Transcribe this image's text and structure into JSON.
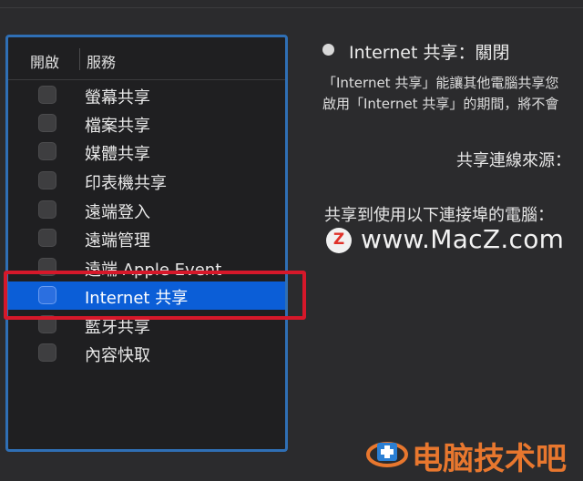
{
  "panel": {
    "header": {
      "enable_col": "開啟",
      "service_col": "服務"
    },
    "services": [
      {
        "label": "螢幕共享",
        "enabled": false,
        "selected": false
      },
      {
        "label": "檔案共享",
        "enabled": false,
        "selected": false
      },
      {
        "label": "媒體共享",
        "enabled": false,
        "selected": false
      },
      {
        "label": "印表機共享",
        "enabled": false,
        "selected": false
      },
      {
        "label": "遠端登入",
        "enabled": false,
        "selected": false
      },
      {
        "label": "遠端管理",
        "enabled": false,
        "selected": false
      },
      {
        "label": "遠端 Apple Event",
        "enabled": false,
        "selected": false
      },
      {
        "label": "Internet 共享",
        "enabled": false,
        "selected": true
      },
      {
        "label": "藍牙共享",
        "enabled": false,
        "selected": false
      },
      {
        "label": "內容快取",
        "enabled": false,
        "selected": false
      }
    ]
  },
  "detail": {
    "status": "Internet 共享：關閉",
    "description_line1": "「Internet 共享」能讓其他電腦共享您",
    "description_line2": "啟用「Internet 共享」的期間，將不會",
    "source_label": "共享連線來源：",
    "to_label": "共享到使用以下連接埠的電腦："
  },
  "watermark": {
    "text": "www.MacZ.com",
    "logo_letter": "Z"
  },
  "branding": {
    "text": "电脑技术吧"
  },
  "colors": {
    "selection": "#0b5ed7",
    "panel_border": "#2f6fb5",
    "highlight_box": "#d6182a",
    "brand": "#e8772e"
  }
}
